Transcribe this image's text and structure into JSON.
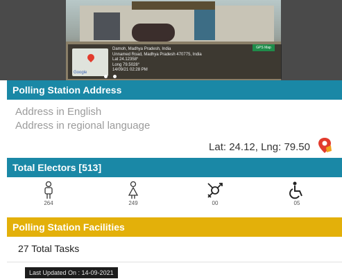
{
  "photo": {
    "location_title": "Damoh, Madhya Pradesh, India",
    "location_lines": [
      "Unnamed Road, Madhya Pradesh 470775, India",
      "Lat 24.12358°",
      "Long 79.5028°",
      "14/09/21 02:28 PM"
    ],
    "map_brand": "Google",
    "badge_label": "GPS Map",
    "carousel_dots": 2
  },
  "address_section": {
    "title": "Polling Station Address",
    "address_english": "Address in English",
    "address_regional": "Address in regional language",
    "latlng": "Lat: 24.12, Lng: 79.50"
  },
  "electors_section": {
    "title": "Total Electors [513]",
    "groups": [
      {
        "icon": "male-voter-icon",
        "count": "264"
      },
      {
        "icon": "female-voter-icon",
        "count": "249"
      },
      {
        "icon": "third-gender-icon",
        "count": "00"
      },
      {
        "icon": "disabled-voter-icon",
        "count": "05"
      }
    ]
  },
  "facilities_section": {
    "title": "Polling Station Facilities",
    "total_tasks": "27 Total Tasks"
  },
  "footer": {
    "last_updated": "Last Updated On : 14-09-2021"
  },
  "colors": {
    "teal_header": "#1a88a6",
    "gold_header": "#e3b00a",
    "map_pin": "#e23b2d"
  }
}
